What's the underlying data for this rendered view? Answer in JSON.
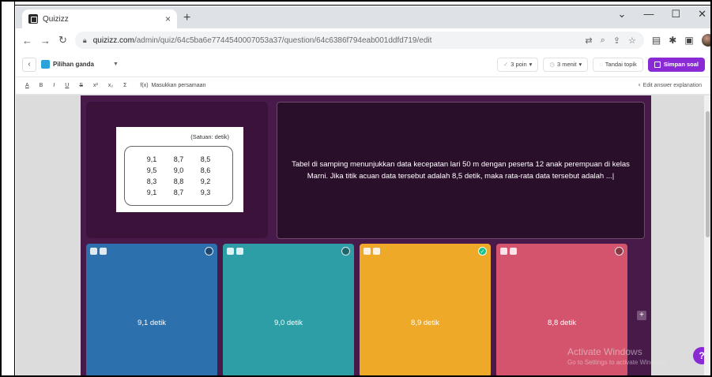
{
  "browser": {
    "tab_title": "Quizizz",
    "tab_close": "×",
    "new_tab": "+",
    "win_min": "—",
    "win_max": "☐",
    "win_close": "✕",
    "url_host": "quizizz.com",
    "url_path": "/admin/quiz/64c5ba6e7744540007053a37/question/64c6386f794eab001ddfd719/edit"
  },
  "toolbar": {
    "back": "‹",
    "question_type": "Pilihan ganda",
    "points": "3 poin",
    "time": "3 menit",
    "topic": "Tandai topik",
    "save": "Simpan soal"
  },
  "format_bar": {
    "items": [
      "A",
      "B",
      "I",
      "U",
      "S",
      "x²",
      "x₂",
      "Σ"
    ],
    "equation": "Masukkan persamaan",
    "explanation": "Edit answer explanation"
  },
  "question": {
    "image": {
      "unit": "(Satuan: detik)",
      "values": [
        "9,1",
        "8,7",
        "8,5",
        "9,5",
        "9,0",
        "8,6",
        "8,3",
        "8,8",
        "9,2",
        "9,1",
        "8,7",
        "9,3"
      ]
    },
    "text": "Tabel di samping menunjukkan data kecepatan lari 50 m dengan peserta 12 anak perempuan di kelas Marni. Jika titik acuan data tersebut adalah 8,5 detik, maka rata-rata data tersebut adalah ...|"
  },
  "answers": [
    {
      "label": "9,1 detik",
      "color": "#2d70ae",
      "correct": false
    },
    {
      "label": "9,0 detik",
      "color": "#2d9da6",
      "correct": false
    },
    {
      "label": "8,9 detik",
      "color": "#efa929",
      "correct": true
    },
    {
      "label": "8,8 detik",
      "color": "#d5546d",
      "correct": false
    }
  ],
  "watermark": {
    "line1": "Activate Windows",
    "line2": "Go to Settings to activate Windows."
  },
  "help": "?"
}
